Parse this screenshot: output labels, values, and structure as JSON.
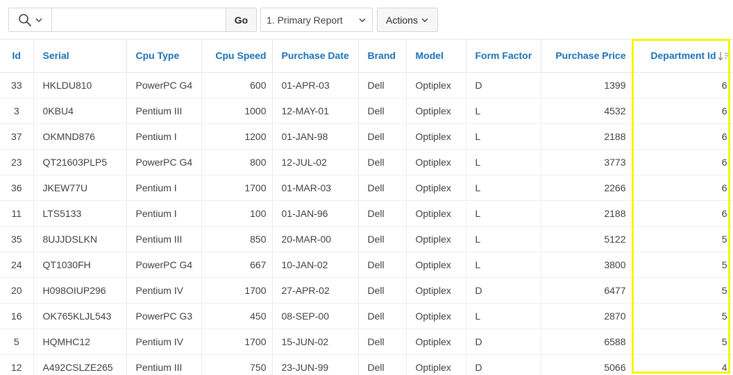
{
  "toolbar": {
    "search_placeholder": "",
    "go_label": "Go",
    "report_selected": "1. Primary Report",
    "actions_label": "Actions"
  },
  "columns": [
    {
      "key": "id",
      "label": "Id"
    },
    {
      "key": "serial",
      "label": "Serial"
    },
    {
      "key": "cpu_type",
      "label": "Cpu Type"
    },
    {
      "key": "cpu_speed",
      "label": "Cpu Speed"
    },
    {
      "key": "purchase_date",
      "label": "Purchase Date"
    },
    {
      "key": "brand",
      "label": "Brand"
    },
    {
      "key": "model",
      "label": "Model"
    },
    {
      "key": "form_factor",
      "label": "Form Factor"
    },
    {
      "key": "purchase_price",
      "label": "Purchase Price"
    },
    {
      "key": "department_id",
      "label": "Department Id"
    }
  ],
  "sort": {
    "column": "department_id",
    "direction": "descending"
  },
  "highlight_color": "#f5f50a",
  "rows": [
    {
      "id": "33",
      "serial": "HKLDU810",
      "cpu_type": "PowerPC G4",
      "cpu_speed": "600",
      "purchase_date": "01-APR-03",
      "brand": "Dell",
      "model": "Optiplex",
      "form_factor": "D",
      "purchase_price": "1399",
      "department_id": "6"
    },
    {
      "id": "3",
      "serial": "0KBU4",
      "cpu_type": "Pentium III",
      "cpu_speed": "1000",
      "purchase_date": "12-MAY-01",
      "brand": "Dell",
      "model": "Optiplex",
      "form_factor": "L",
      "purchase_price": "4532",
      "department_id": "6"
    },
    {
      "id": "37",
      "serial": "OKMND876",
      "cpu_type": "Pentium I",
      "cpu_speed": "1200",
      "purchase_date": "01-JAN-98",
      "brand": "Dell",
      "model": "Optiplex",
      "form_factor": "L",
      "purchase_price": "2188",
      "department_id": "6"
    },
    {
      "id": "23",
      "serial": "QT21603PLP5",
      "cpu_type": "PowerPC G4",
      "cpu_speed": "800",
      "purchase_date": "12-JUL-02",
      "brand": "Dell",
      "model": "Optiplex",
      "form_factor": "L",
      "purchase_price": "3773",
      "department_id": "6"
    },
    {
      "id": "36",
      "serial": "JKEW77U",
      "cpu_type": "Pentium I",
      "cpu_speed": "1700",
      "purchase_date": "01-MAR-03",
      "brand": "Dell",
      "model": "Optiplex",
      "form_factor": "L",
      "purchase_price": "2266",
      "department_id": "6"
    },
    {
      "id": "11",
      "serial": "LTS5133",
      "cpu_type": "Pentium I",
      "cpu_speed": "100",
      "purchase_date": "01-JAN-96",
      "brand": "Dell",
      "model": "Optiplex",
      "form_factor": "L",
      "purchase_price": "2188",
      "department_id": "6"
    },
    {
      "id": "35",
      "serial": "8UJJDSLKN",
      "cpu_type": "Pentium III",
      "cpu_speed": "850",
      "purchase_date": "20-MAR-00",
      "brand": "Dell",
      "model": "Optiplex",
      "form_factor": "L",
      "purchase_price": "5122",
      "department_id": "5"
    },
    {
      "id": "24",
      "serial": "QT1030FH",
      "cpu_type": "PowerPC G4",
      "cpu_speed": "667",
      "purchase_date": "10-JAN-02",
      "brand": "Dell",
      "model": "Optiplex",
      "form_factor": "L",
      "purchase_price": "3800",
      "department_id": "5"
    },
    {
      "id": "20",
      "serial": "H098OIUP296",
      "cpu_type": "Pentium IV",
      "cpu_speed": "1700",
      "purchase_date": "27-APR-02",
      "brand": "Dell",
      "model": "Optiplex",
      "form_factor": "D",
      "purchase_price": "6477",
      "department_id": "5"
    },
    {
      "id": "16",
      "serial": "OK765KLJL543",
      "cpu_type": "PowerPC G3",
      "cpu_speed": "450",
      "purchase_date": "08-SEP-00",
      "brand": "Dell",
      "model": "Optiplex",
      "form_factor": "L",
      "purchase_price": "2870",
      "department_id": "5"
    },
    {
      "id": "5",
      "serial": "HQMHC12",
      "cpu_type": "Pentium IV",
      "cpu_speed": "1700",
      "purchase_date": "15-JUN-02",
      "brand": "Dell",
      "model": "Optiplex",
      "form_factor": "D",
      "purchase_price": "6588",
      "department_id": "5"
    },
    {
      "id": "12",
      "serial": "A492CSLZE265",
      "cpu_type": "Pentium III",
      "cpu_speed": "750",
      "purchase_date": "23-JUN-99",
      "brand": "Dell",
      "model": "Optiplex",
      "form_factor": "D",
      "purchase_price": "5066",
      "department_id": "4"
    }
  ]
}
